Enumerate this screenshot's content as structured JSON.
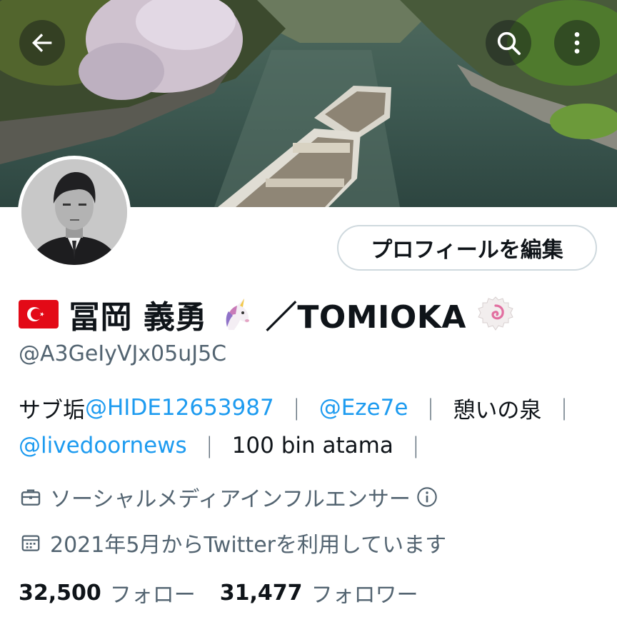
{
  "header": {
    "back_icon": "arrow-left-icon",
    "search_icon": "search-icon",
    "more_icon": "more-vertical-icon"
  },
  "profile": {
    "edit_button_label": "プロフィールを編集",
    "flag_emoji": "🇹🇷",
    "name_main": "冨岡 義勇",
    "unicorn_emoji": "🦄",
    "name_suffix": "／TOMIOKA",
    "narutomaki_emoji": "🍥",
    "handle": "@A3GeIyVJx05uJ5C"
  },
  "bio": {
    "line1": [
      {
        "text": "サブ垢 ",
        "type": "text"
      },
      {
        "text": "@HIDE12653987",
        "type": "link"
      },
      {
        "text": "｜",
        "type": "sep"
      },
      {
        "text": "@Eze7e",
        "type": "link"
      },
      {
        "text": "｜",
        "type": "sep"
      },
      {
        "text": "憩いの泉",
        "type": "text"
      },
      {
        "text": "｜",
        "type": "sep"
      }
    ],
    "line2": [
      {
        "text": "@livedoornews",
        "type": "link"
      },
      {
        "text": "｜",
        "type": "sep"
      },
      {
        "text": "100 bin atama",
        "type": "text"
      },
      {
        "text": "｜",
        "type": "sep"
      }
    ]
  },
  "meta": {
    "category": "ソーシャルメディアインフルエンサー",
    "category_icon": "briefcase-icon",
    "info_icon": "info-icon",
    "joined": "2021年5月からTwitterを利用しています",
    "joined_icon": "calendar-icon"
  },
  "stats": {
    "following_count": "32,500",
    "following_label": "フォロー",
    "followers_count": "31,477",
    "followers_label": "フォロワー"
  },
  "colors": {
    "link": "#1d9bf0",
    "secondary_text": "#536471",
    "primary_text": "#0f1419",
    "border": "#cfd9de"
  }
}
